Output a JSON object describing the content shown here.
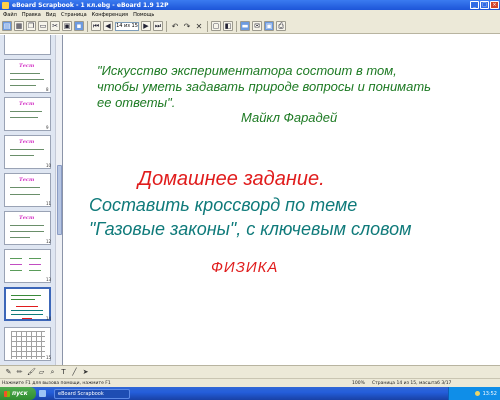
{
  "window": {
    "title": "eBoard Scrapbook - 1 кл.ebg - eBoard 1.9 12P"
  },
  "menu": [
    "Файл",
    "Правка",
    "Вид",
    "Страница",
    "Конференция",
    "Помощь"
  ],
  "toolbar": {
    "page_counter": "14 из 15"
  },
  "sidebar": {
    "thumbnails": [
      {
        "num": "8",
        "title": "Тест"
      },
      {
        "num": "9",
        "title": "Тест"
      },
      {
        "num": "10",
        "title": "Тест"
      },
      {
        "num": "11",
        "title": "Тест"
      },
      {
        "num": "12",
        "title": "Тест"
      },
      {
        "num": "13",
        "title": ""
      },
      {
        "num": "14",
        "title": ""
      },
      {
        "num": "15",
        "title": ""
      }
    ]
  },
  "slide": {
    "quote": "\"Искусство экспериментатора состоит в том, чтобы уметь задавать природе вопросы и понимать ее ответы\".",
    "author": "Майкл Фарадей",
    "homework_title": "Домашнее задание.",
    "homework_line1": "Составить кроссворд по теме",
    "homework_line2": "\"Газовые законы\", с ключевым словом",
    "keyword": "ФИЗИКА"
  },
  "status": {
    "hint": "Нажмите F1 для вызова помощи, нажмите F1",
    "zoom": "100%",
    "page": "Страница 14 из 15, масштаб 3/17"
  },
  "taskbar": {
    "start_label": "пуск",
    "task_label": "eBoard Scrapbook",
    "clock": "13:52"
  },
  "colors": {
    "quote": "#1d7a23",
    "homework_title": "#e01c1c",
    "homework_body": "#0f7a7a",
    "keyword": "#e01c1c"
  }
}
